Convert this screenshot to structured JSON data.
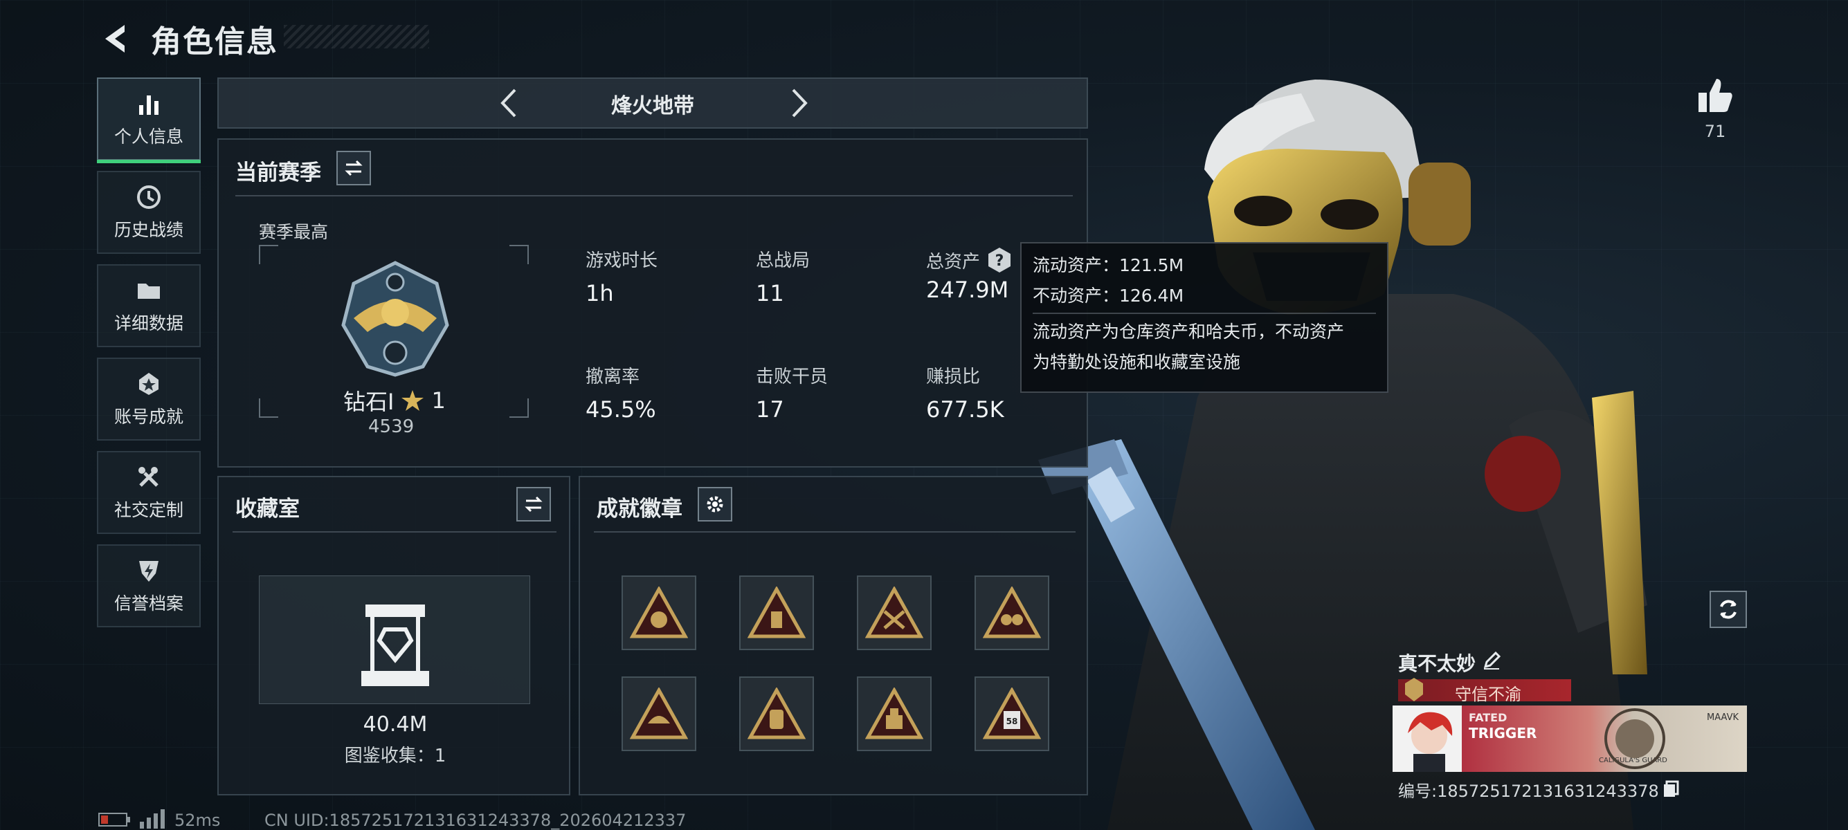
{
  "header": {
    "title": "角色信息"
  },
  "sidebar": {
    "items": [
      {
        "label": "个人信息",
        "icon": "bar-chart-icon",
        "active": true
      },
      {
        "label": "历史战绩",
        "icon": "history-clock-icon"
      },
      {
        "label": "详细数据",
        "icon": "folder-icon"
      },
      {
        "label": "账号成就",
        "icon": "achievement-badge-icon"
      },
      {
        "label": "社交定制",
        "icon": "tools-icon"
      },
      {
        "label": "信誉档案",
        "icon": "shield-lightning-icon"
      }
    ]
  },
  "mode_selector": {
    "name": "烽火地带"
  },
  "season": {
    "title": "当前赛季",
    "best_label": "赛季最高",
    "rank_name": "钻石Ⅰ",
    "rank_stars": "1",
    "rank_score": "4539",
    "stats": [
      {
        "label": "游戏时长",
        "value": "1h"
      },
      {
        "label": "总战局",
        "value": "11"
      },
      {
        "label": "总资产",
        "value": "247.9M",
        "has_help": true
      },
      {
        "label": "撤离率",
        "value": "45.5%"
      },
      {
        "label": "击败干员",
        "value": "17"
      },
      {
        "label": "赚损比",
        "value": "677.5K"
      }
    ]
  },
  "tooltip": {
    "liquid": "流动资产：121.5M",
    "fixed": "不动资产：126.4M",
    "desc_line1": "流动资产为仓库资产和哈夫币，不动资产",
    "desc_line2": "为特勤处设施和收藏室设施"
  },
  "collection": {
    "title": "收藏室",
    "value": "40.4M",
    "catalog": "图鉴收集：1"
  },
  "badges": {
    "title": "成就徽章",
    "count": 8,
    "color": "#c4a15a"
  },
  "likes": {
    "count": "71"
  },
  "profile": {
    "name": "真不太妙",
    "title_badge": "守信不渝",
    "id_label": "编号:1857251721316312433​78",
    "banner_text_1": "FATED",
    "banner_text_2": "TRIGGER",
    "banner_text_3": "MAAVK",
    "banner_text_4": "CALIGULA'S GUARD"
  },
  "status_bar": {
    "ping": "52ms",
    "uid": "CN UID:18572517213163124337​8_202604212337"
  },
  "colors": {
    "accent_green": "#3fd07c",
    "tooltip_bg": "#0a0e12",
    "title_badge_red": "#8c1e24"
  }
}
